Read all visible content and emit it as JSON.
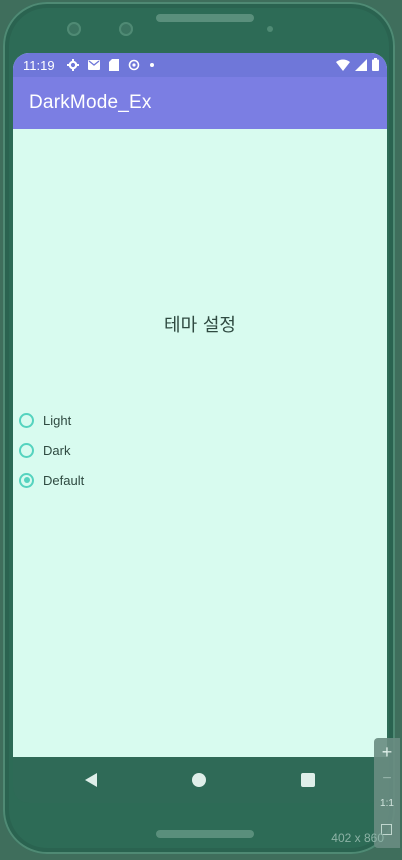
{
  "status_bar": {
    "time": "11:19",
    "icons": [
      "gear-icon",
      "mail-icon",
      "sim-card-icon",
      "sync-icon",
      "dot-icon"
    ],
    "right_icons": [
      "wifi-icon",
      "signal-icon",
      "battery-icon"
    ]
  },
  "app_bar": {
    "title": "DarkMode_Ex"
  },
  "content": {
    "heading": "테마 설정",
    "options": [
      {
        "label": "Light",
        "checked": false
      },
      {
        "label": "Dark",
        "checked": false
      },
      {
        "label": "Default",
        "checked": true
      }
    ]
  },
  "emulator": {
    "size_label": "402 x 860",
    "zoom_in": "+",
    "zoom_out": "−",
    "zoom_actual": "1:1"
  },
  "colors": {
    "status_bar": "#6f77d9",
    "app_bar": "#7b7ee3",
    "background": "#d8fbef",
    "radio_accent": "#55d3bf"
  }
}
